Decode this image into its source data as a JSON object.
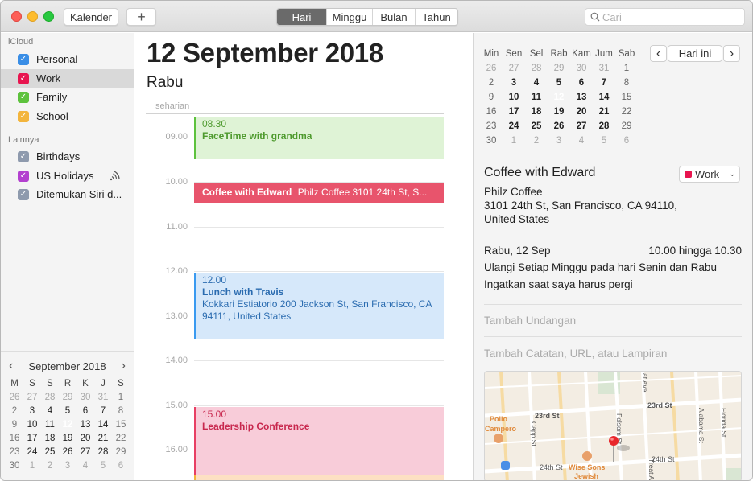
{
  "toolbar": {
    "calendars_button": "Kalender",
    "add_button": "+",
    "view_tabs": [
      {
        "label": "Hari",
        "active": true
      },
      {
        "label": "Minggu",
        "active": false
      },
      {
        "label": "Bulan",
        "active": false
      },
      {
        "label": "Tahun",
        "active": false
      }
    ],
    "search_placeholder": "Cari"
  },
  "sidebar": {
    "sections": [
      {
        "title": "iCloud",
        "calendars": [
          {
            "label": "Personal",
            "color": "#3a8ee6",
            "checked": true,
            "selected": false
          },
          {
            "label": "Work",
            "color": "#e8154f",
            "checked": true,
            "selected": true
          },
          {
            "label": "Family",
            "color": "#5dc23d",
            "checked": true,
            "selected": false
          },
          {
            "label": "School",
            "color": "#f3b53d",
            "checked": true,
            "selected": false
          }
        ]
      },
      {
        "title": "Lainnya",
        "calendars": [
          {
            "label": "Birthdays",
            "color": "#8e9aad",
            "checked": true,
            "selected": false
          },
          {
            "label": "US Holidays",
            "color": "#b340cf",
            "checked": true,
            "selected": false,
            "subscribed_icon": "broadcast-icon"
          },
          {
            "label": "Ditemukan Siri d...",
            "color": "#8e9aad",
            "checked": true,
            "selected": false
          }
        ]
      }
    ],
    "mini_calendar": {
      "month_label": "September 2018",
      "prev_icon": "‹",
      "next_icon": "›",
      "weekday_headers": [
        "M",
        "S",
        "S",
        "R",
        "K",
        "J",
        "S"
      ],
      "weeks": [
        [
          "26",
          "27",
          "28",
          "29",
          "30",
          "31",
          "1"
        ],
        [
          "2",
          "3",
          "4",
          "5",
          "6",
          "7",
          "8"
        ],
        [
          "9",
          "10",
          "11",
          "12",
          "13",
          "14",
          "15"
        ],
        [
          "16",
          "17",
          "18",
          "19",
          "20",
          "21",
          "22"
        ],
        [
          "23",
          "24",
          "25",
          "26",
          "27",
          "28",
          "29"
        ],
        [
          "30",
          "1",
          "2",
          "3",
          "4",
          "5",
          "6"
        ]
      ],
      "today": "12"
    }
  },
  "day_view": {
    "date_title": "12 September 2018",
    "weekday": "Rabu",
    "all_day_label": "seharian",
    "hours": [
      "09.00",
      "10.00",
      "11.00",
      "12.00",
      "13.00",
      "14.00",
      "15.00",
      "16.00"
    ],
    "events": [
      {
        "time": "08.30",
        "title": "FaceTime with grandma",
        "location": "",
        "calendar": "Family",
        "bg": "#dff3d6",
        "border": "#5dc23d",
        "text": "#4e9a2e"
      },
      {
        "time": "",
        "title": "Coffee with Edward",
        "location": "Philz Coffee 3101 24th St, S...",
        "calendar": "Work",
        "bg": "#e8546c",
        "border": "#e8546c",
        "text": "#ffffff"
      },
      {
        "time": "12.00",
        "title": "Lunch with Travis",
        "location": "Kokkari Estiatorio 200 Jackson St, San Francisco, CA  94111, United States",
        "calendar": "Personal",
        "bg": "#d6e8fa",
        "border": "#3a9af0",
        "text": "#2b6cb0"
      },
      {
        "time": "15.00",
        "title": "Leadership Conference",
        "location": "",
        "calendar": "Work",
        "bg": "#f8ccd9",
        "border": "#e83f63",
        "text": "#c8284e"
      }
    ]
  },
  "inspector": {
    "mini_calendar": {
      "weekday_headers": [
        "Min",
        "Sen",
        "Sel",
        "Rab",
        "Kam",
        "Jum",
        "Sab"
      ],
      "weeks": [
        [
          "26",
          "27",
          "28",
          "29",
          "30",
          "31",
          "1"
        ],
        [
          "2",
          "3",
          "4",
          "5",
          "6",
          "7",
          "8"
        ],
        [
          "9",
          "10",
          "11",
          "12",
          "13",
          "14",
          "15"
        ],
        [
          "16",
          "17",
          "18",
          "19",
          "20",
          "21",
          "22"
        ],
        [
          "23",
          "24",
          "25",
          "26",
          "27",
          "28",
          "29"
        ],
        [
          "30",
          "1",
          "2",
          "3",
          "4",
          "5",
          "6"
        ]
      ],
      "today": "12",
      "prev_icon": "‹",
      "today_button": "Hari ini",
      "next_icon": "›"
    },
    "event": {
      "title": "Coffee with Edward",
      "calendar": "Work",
      "calendar_color": "#e8154f",
      "location_name": "Philz Coffee",
      "address_line1": "3101 24th St, San Francisco, CA  94110,",
      "address_line2": "United States",
      "date": "Rabu, 12 Sep",
      "time_range": "10.00 hingga 10.30",
      "repeat": "Ulangi Setiap Minggu pada hari Senin dan Rabu",
      "alert": "Ingatkan saat saya harus pergi",
      "add_invitees": "Tambah Undangan",
      "add_notes": "Tambah Catatan, URL, atau Lampiran"
    },
    "map": {
      "streets": [
        "23rd St",
        "23rd St",
        "24th St",
        "24th St",
        "Capp St",
        "Folsom St",
        "Alabama St",
        "Florida St",
        "Treat Ave",
        "at Ave",
        "St"
      ],
      "places": [
        {
          "name": "Pollo Campero",
          "line1": "Pollo",
          "line2": "Campero"
        },
        {
          "name": "Wise Sons Jewish",
          "line1": "Wise Sons",
          "line2": "Jewish"
        }
      ]
    }
  }
}
